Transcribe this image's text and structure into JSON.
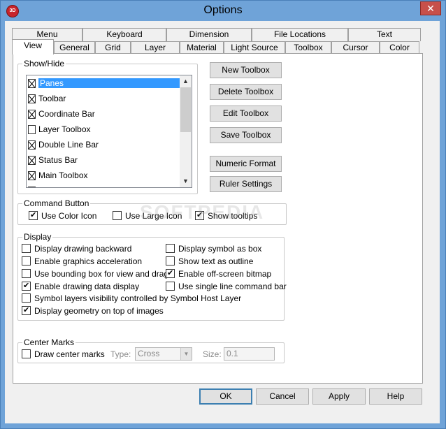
{
  "window": {
    "title": "Options",
    "close": "✕",
    "app_icon": "3D"
  },
  "tabs_row1": [
    "Menu",
    "Keyboard",
    "Dimension",
    "File Locations",
    "Text"
  ],
  "tabs_row2": [
    "View",
    "General",
    "Grid",
    "Layer",
    "Material",
    "Light Source",
    "Toolbox",
    "Cursor",
    "Color"
  ],
  "show_hide": {
    "label": "Show/Hide",
    "items": [
      {
        "label": "Panes",
        "checked": true,
        "selected": true
      },
      {
        "label": "Toolbar",
        "checked": true,
        "selected": false
      },
      {
        "label": "Coordinate Bar",
        "checked": true,
        "selected": false
      },
      {
        "label": "Layer Toolbox",
        "checked": false,
        "selected": false
      },
      {
        "label": "Double Line Bar",
        "checked": true,
        "selected": false
      },
      {
        "label": "Status Bar",
        "checked": true,
        "selected": false
      },
      {
        "label": "Main Toolbox",
        "checked": true,
        "selected": false
      }
    ],
    "scroll_up": "▲",
    "scroll_down": "▼"
  },
  "toolbox_buttons": {
    "new": "New Toolbox",
    "delete": "Delete Toolbox",
    "edit": "Edit Toolbox",
    "save": "Save Toolbox",
    "numeric": "Numeric Format",
    "ruler": "Ruler Settings"
  },
  "command_button": {
    "label": "Command Button",
    "use_color_icon": {
      "label": "Use Color Icon",
      "checked": true
    },
    "use_large_icon": {
      "label": "Use Large Icon",
      "checked": false
    },
    "show_tooltips": {
      "label": "Show tooltips",
      "checked": true
    }
  },
  "display": {
    "label": "Display",
    "left": [
      {
        "label": "Display drawing backward",
        "checked": false
      },
      {
        "label": "Enable graphics acceleration",
        "checked": false
      },
      {
        "label": "Use bounding box for view and drag",
        "checked": false
      },
      {
        "label": "Enable drawing data display",
        "checked": true
      },
      {
        "label": "Symbol layers visibility controlled by Symbol Host Layer",
        "checked": false
      },
      {
        "label": "Display geometry on top of images",
        "checked": true
      }
    ],
    "right": [
      {
        "label": "Display symbol as box",
        "checked": false
      },
      {
        "label": "Show text as outline",
        "checked": false
      },
      {
        "label": "Enable off-screen bitmap",
        "checked": true
      },
      {
        "label": "Use single line command bar",
        "checked": false
      }
    ]
  },
  "center_marks": {
    "label": "Center Marks",
    "draw": {
      "label": "Draw center marks",
      "checked": false
    },
    "type_label": "Type:",
    "type_value": "Cross",
    "size_label": "Size:",
    "size_value": "0.1"
  },
  "footer": {
    "ok": "OK",
    "cancel": "Cancel",
    "apply": "Apply",
    "help": "Help"
  },
  "watermark": "SOFTPEDIA"
}
